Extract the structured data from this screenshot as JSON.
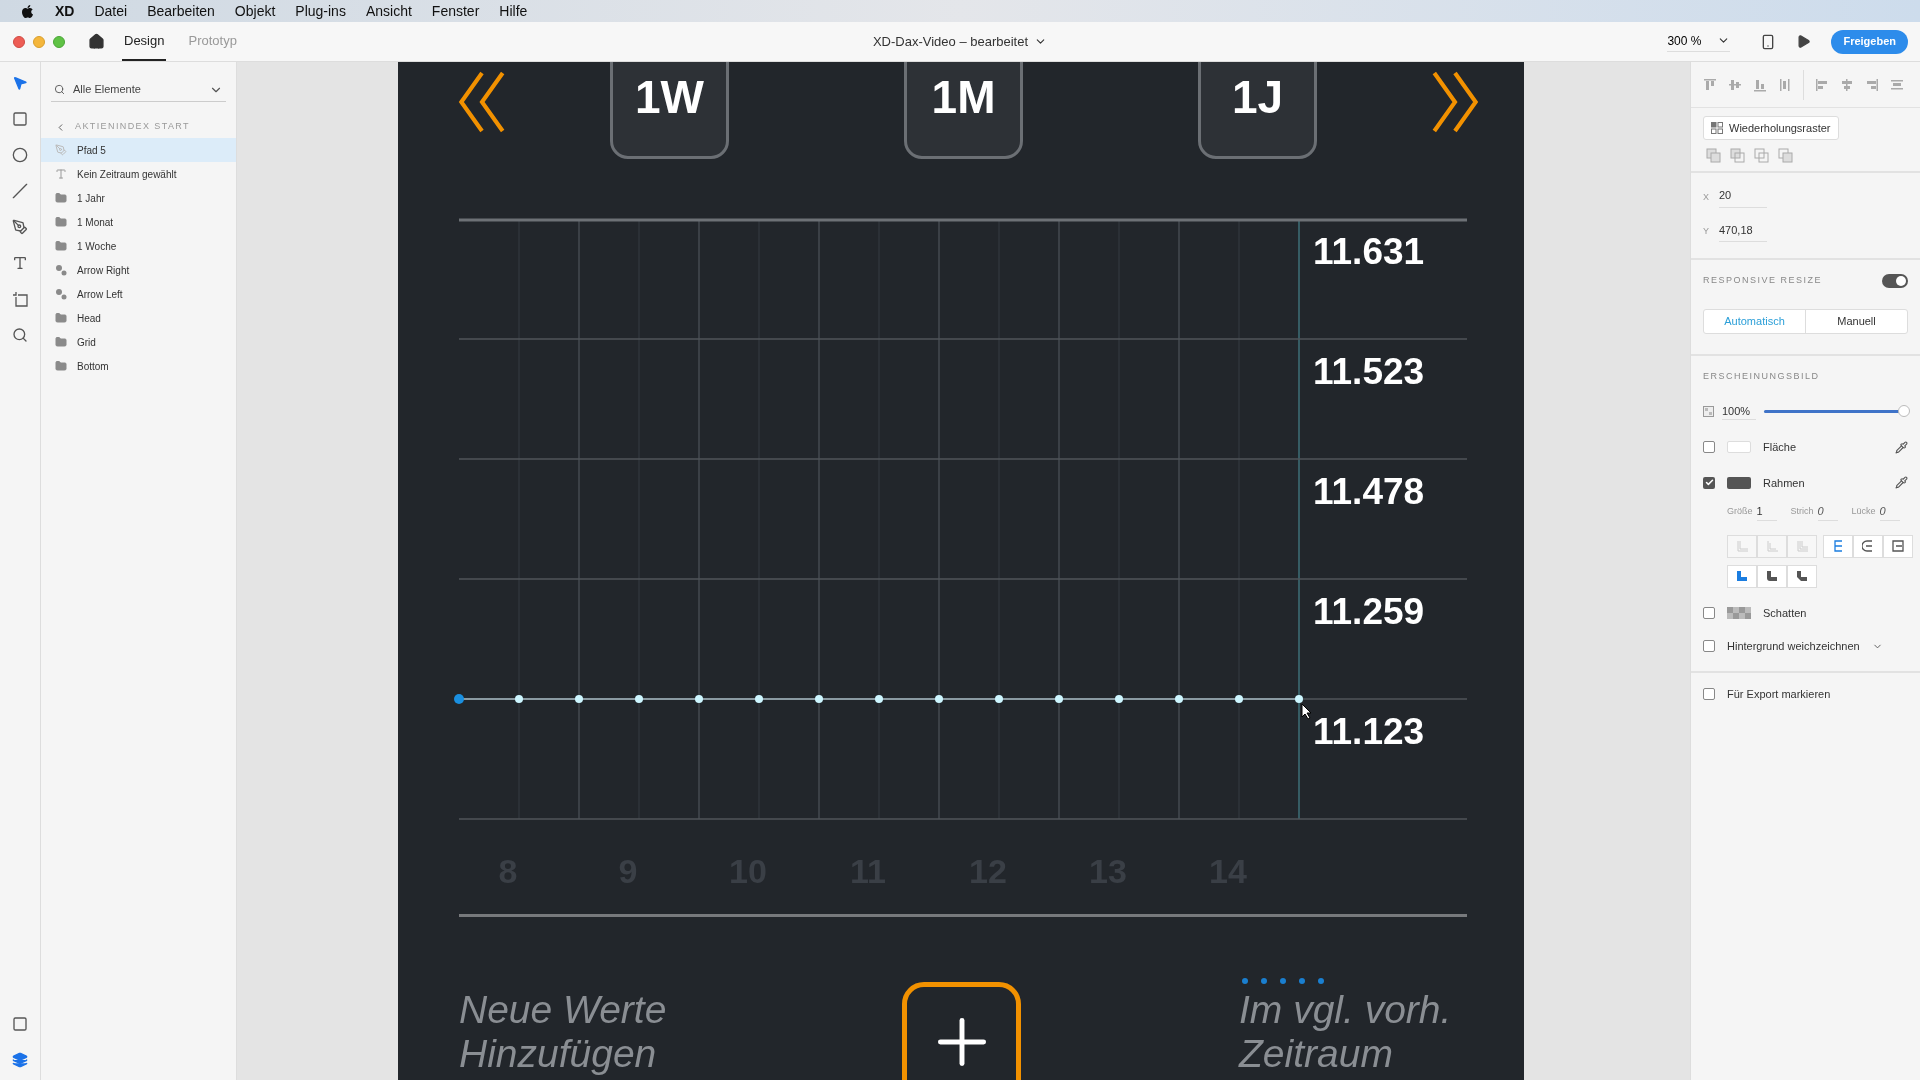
{
  "menu_bar": {
    "app": "XD",
    "items": [
      "Datei",
      "Bearbeiten",
      "Objekt",
      "Plug-ins",
      "Ansicht",
      "Fenster",
      "Hilfe"
    ]
  },
  "toolbar": {
    "tabs": [
      {
        "label": "Design",
        "selected": true
      },
      {
        "label": "Prototyp",
        "selected": false
      }
    ],
    "document_title": "XD-Dax-Video – bearbeitet",
    "zoom": "300 %",
    "share_button": "Freigeben"
  },
  "tools": [
    {
      "kind": "select",
      "selected": true
    },
    {
      "kind": "rectangle",
      "selected": false
    },
    {
      "kind": "ellipse",
      "selected": false
    },
    {
      "kind": "line",
      "selected": false
    },
    {
      "kind": "pen",
      "selected": false
    },
    {
      "kind": "text",
      "selected": false
    },
    {
      "kind": "artboard",
      "selected": false
    },
    {
      "kind": "zoom",
      "selected": false
    }
  ],
  "panel_toggles": [
    {
      "kind": "assets",
      "selected": false
    },
    {
      "kind": "layers",
      "selected": true
    }
  ],
  "layers": {
    "filter": "Alle Elemente",
    "breadcrumb": "AKTIENINDEX START",
    "items": [
      {
        "name": "Pfad 5",
        "kind": "path",
        "selected": true
      },
      {
        "name": "Kein Zeitraum gewählt",
        "kind": "text",
        "selected": false
      },
      {
        "name": "1 Jahr",
        "kind": "group",
        "selected": false
      },
      {
        "name": "1 Monat",
        "kind": "group",
        "selected": false
      },
      {
        "name": "1 Woche",
        "kind": "group",
        "selected": false
      },
      {
        "name": "Arrow Right",
        "kind": "component",
        "selected": false
      },
      {
        "name": "Arrow Left",
        "kind": "component",
        "selected": false
      },
      {
        "name": "Head",
        "kind": "group",
        "selected": false
      },
      {
        "name": "Grid",
        "kind": "group",
        "selected": false
      },
      {
        "name": "Bottom",
        "kind": "group",
        "selected": false
      }
    ]
  },
  "artboard": {
    "period_buttons": [
      "1W",
      "1M",
      "1J"
    ],
    "y_values": [
      "11.631",
      "11.523",
      "11.478",
      "11.259",
      "11.123"
    ],
    "x_labels": [
      "8",
      "9",
      "10",
      "11",
      "12",
      "13",
      "14"
    ],
    "add_label": [
      "Neue Werte",
      "Hinzufügen"
    ],
    "compare_label": [
      "Im vgl. vorh.",
      "Zeitraum"
    ]
  },
  "inspector": {
    "repeat_grid_button": "Wiederholungsraster",
    "position": [
      {
        "label": "X",
        "value": "20"
      },
      {
        "label": "Y",
        "value": "470,18"
      }
    ],
    "responsive_resize": {
      "title": "RESPONSIVE RESIZE",
      "on": true,
      "options": [
        {
          "label": "Automatisch",
          "selected": true
        },
        {
          "label": "Manuell",
          "selected": false
        }
      ]
    },
    "appearance": {
      "title": "ERSCHEINUNGSBILD",
      "opacity": "100%",
      "level": 1
    },
    "properties": [
      {
        "kind": "fill",
        "label": "Fläche",
        "checked": false
      },
      {
        "kind": "border",
        "label": "Rahmen",
        "checked": true
      }
    ],
    "stroke": [
      {
        "label": "Größe",
        "value": "1"
      },
      {
        "label": "Strich",
        "value": "0"
      },
      {
        "label": "Lücke",
        "value": "0"
      }
    ],
    "cap_buttons": [
      {
        "disabled": true
      },
      {
        "disabled": true
      },
      {
        "disabled": true
      }
    ],
    "align_buttons": [
      {
        "selected": true
      },
      {
        "selected": false
      },
      {
        "selected": false
      }
    ],
    "join_buttons": [
      {
        "selected": true
      },
      {
        "selected": false
      },
      {
        "selected": false
      }
    ],
    "effects": [
      {
        "kind": "shadow",
        "label": "Schatten",
        "checked": false
      },
      {
        "kind": "blur",
        "label": "Hintergrund weichzeichnen",
        "checked": false
      }
    ],
    "export": {
      "label": "Für Export markieren",
      "checked": false
    }
  }
}
